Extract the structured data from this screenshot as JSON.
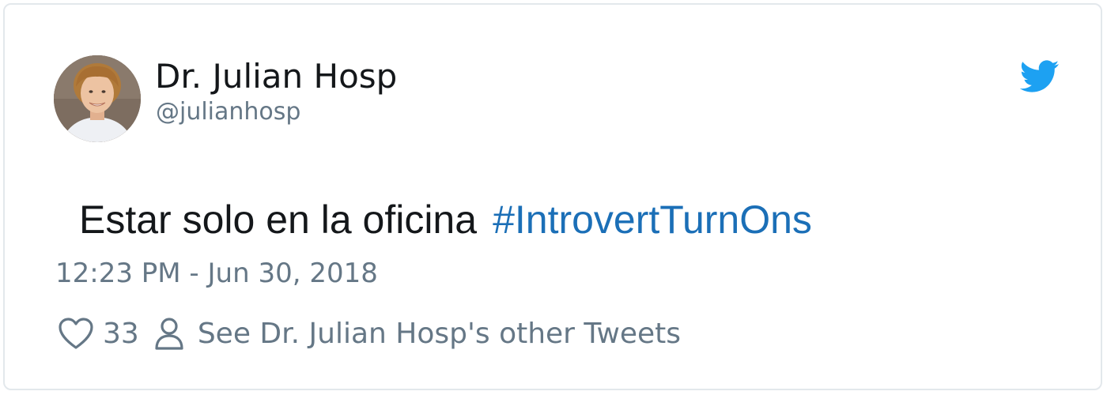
{
  "tweet": {
    "author": {
      "display_name": "Dr. Julian Hosp",
      "handle": "@julianhosp",
      "avatar_icon": "profile-photo"
    },
    "platform_icon": "twitter-bird-icon",
    "brand_color": "#1da1f2",
    "text": "Estar solo en la oficina",
    "hashtag": "#IntrovertTurnOns",
    "hashtag_color": "#1b6fb7",
    "timestamp": "12:23 PM - Jun 30, 2018",
    "likes": "33",
    "like_icon": "heart-icon",
    "see_more_icon": "person-icon",
    "see_more_label": "See Dr. Julian Hosp's other Tweets"
  }
}
